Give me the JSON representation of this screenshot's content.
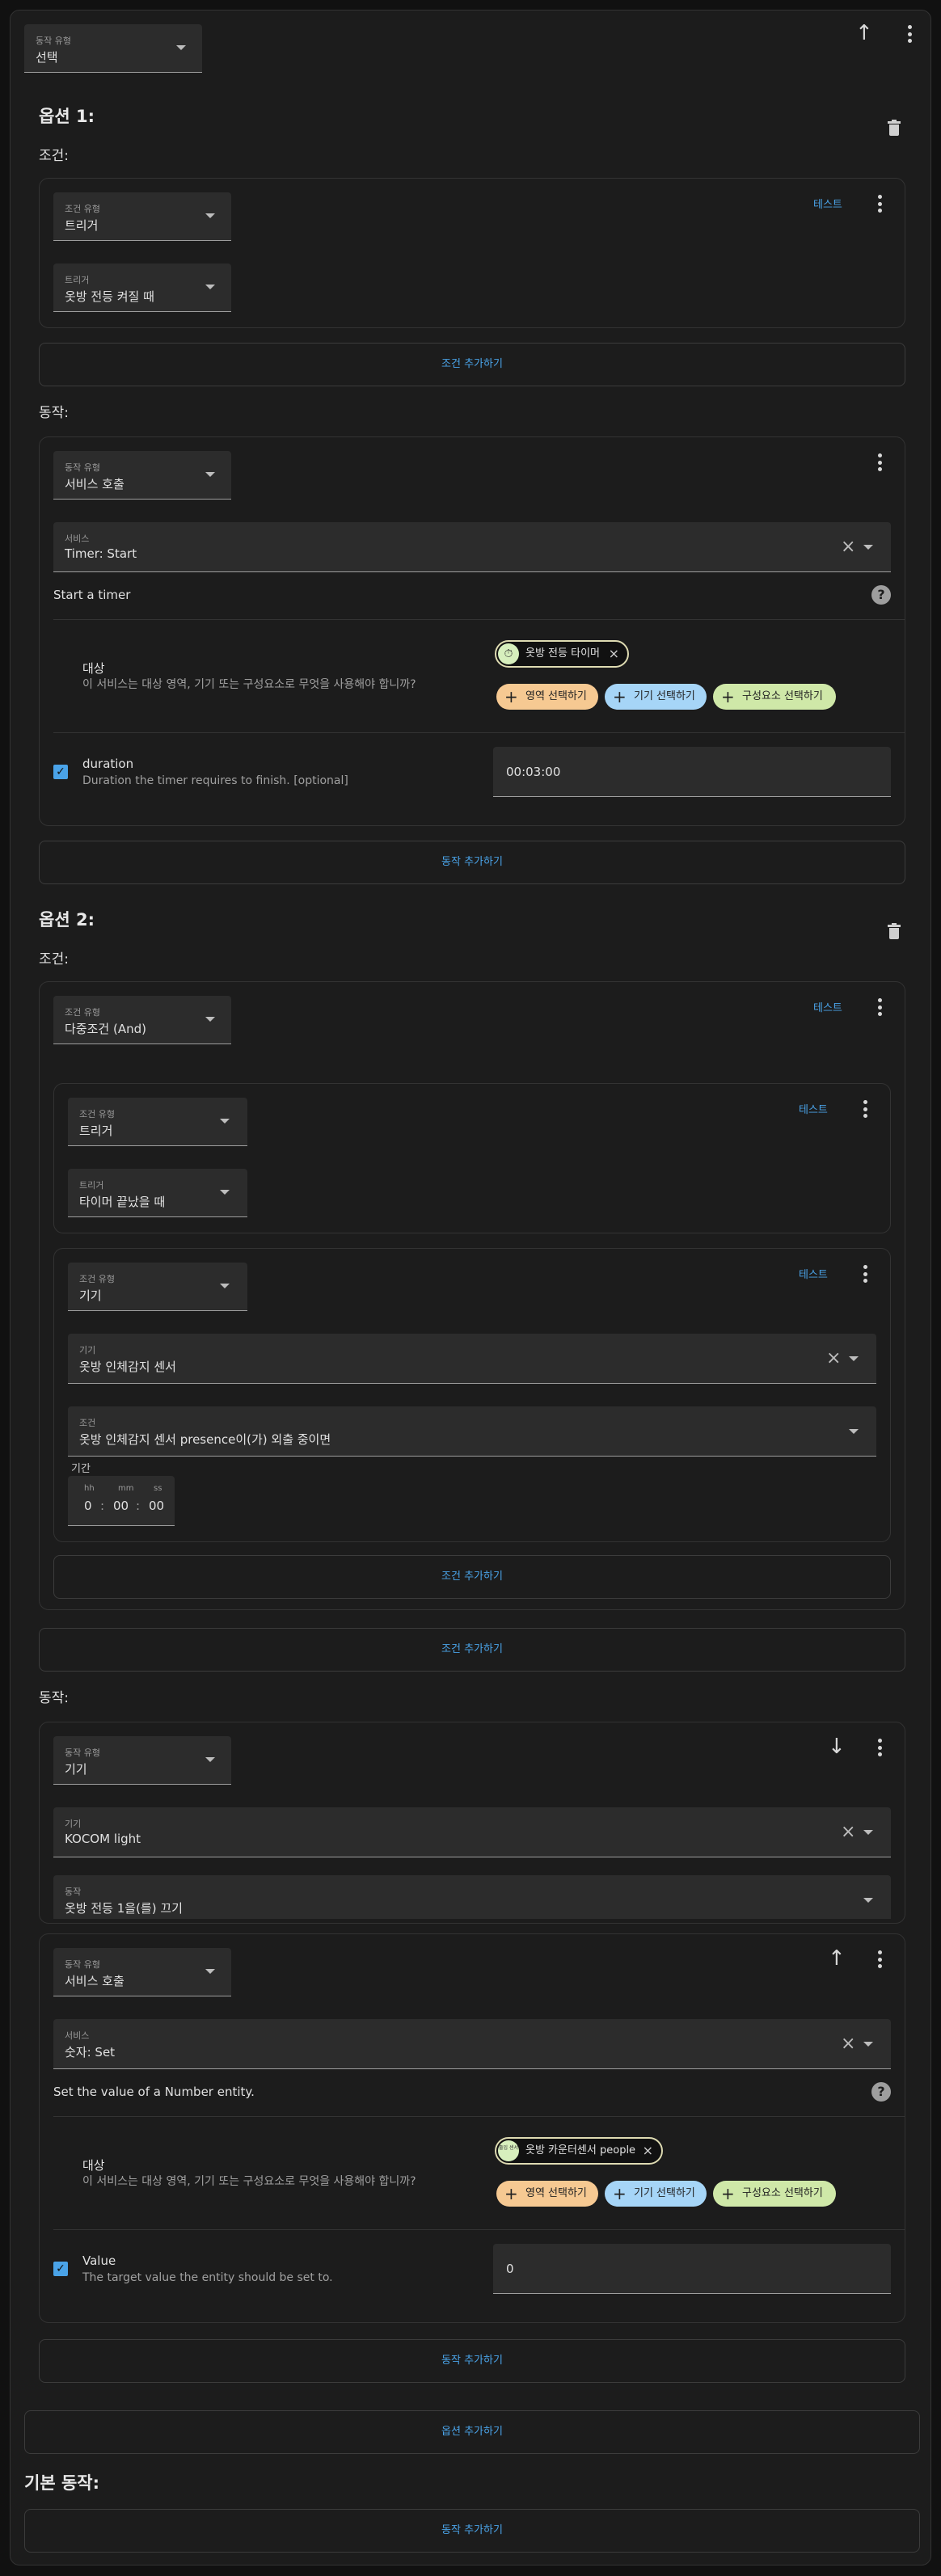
{
  "top": {
    "action_type_label": "동작 유형",
    "action_type_value": "선택"
  },
  "option1": {
    "title": "옵션 1:",
    "conditions_label": "조건:",
    "condition": {
      "type_label": "조건 유형",
      "type_value": "트리거",
      "trigger_label": "트리거",
      "trigger_value": "옷방 전등 켜질 때",
      "test_label": "테스트"
    },
    "add_condition_label": "조건 추가하기",
    "actions_label": "동작:",
    "action": {
      "type_label": "동작 유형",
      "type_value": "서비스 호출",
      "service_label": "서비스",
      "service_value": "Timer: Start",
      "description": "Start a timer",
      "target_label": "대상",
      "target_desc": "이 서비스는 대상 영역, 기기 또는 구성요소로 무엇을 사용해야 합니까?",
      "target_chip": "옷방 전등 타이머",
      "area_chip": "영역 선택하기",
      "device_chip": "기기 선택하기",
      "entity_chip": "구성요소 선택하기",
      "param_name": "duration",
      "param_desc": "Duration the timer requires to finish. [optional]",
      "param_value": "00:03:00"
    },
    "add_action_label": "동작 추가하기"
  },
  "option2": {
    "title": "옵션 2:",
    "conditions_label": "조건:",
    "condition": {
      "type_label": "조건 유형",
      "type_value": "다중조건 (And)",
      "test_label": "테스트",
      "sub1": {
        "type_label": "조건 유형",
        "type_value": "트리거",
        "trigger_label": "트리거",
        "trigger_value": "타이머 끝났을 때",
        "test_label": "테스트"
      },
      "sub2": {
        "type_label": "조건 유형",
        "type_value": "기기",
        "test_label": "테스트",
        "device_label": "기기",
        "device_value": "옷방 인체감지 센서",
        "cond_label": "조건",
        "cond_value": "옷방 인체감지 센서 presence이(가) 외출 중이면",
        "period_label": "기간",
        "hh_label": "hh",
        "mm_label": "mm",
        "ss_label": "ss",
        "hh_value": "0",
        "mm_value": "00",
        "ss_value": "00"
      },
      "inner_add_condition_label": "조건 추가하기"
    },
    "add_condition_label": "조건 추가하기",
    "actions_label": "동작:",
    "action1": {
      "type_label": "동작 유형",
      "type_value": "기기",
      "device_label": "기기",
      "device_value": "KOCOM light",
      "action_label": "동작",
      "action_value": "옷방 전등 1을(를) 끄기"
    },
    "action2": {
      "type_label": "동작 유형",
      "type_value": "서비스 호출",
      "service_label": "서비스",
      "service_value": "숫자: Set",
      "description": "Set the value of a Number entity.",
      "target_label": "대상",
      "target_desc": "이 서비스는 대상 영역, 기기 또는 구성요소로 무엇을 사용해야 합니까?",
      "target_chip": "옷방 카운터센서 people",
      "target_chip_icon": "출입 센서",
      "area_chip": "영역 선택하기",
      "device_chip": "기기 선택하기",
      "entity_chip": "구성요소 선택하기",
      "param_name": "Value",
      "param_desc": "The target value the entity should be set to.",
      "param_value": "0"
    },
    "add_action_label": "동작 추가하기"
  },
  "add_option_label": "옵션 추가하기",
  "default_actions_title": "기본 동작:",
  "default_add_action_label": "동작 추가하기",
  "accent_color": "#4aa3e8",
  "icons": [
    "arrow-up-icon",
    "arrow-down-icon",
    "more-vert-icon",
    "delete-icon",
    "close-icon",
    "chevron-down-icon",
    "help-icon",
    "timer-icon",
    "plus-icon",
    "checkbox-icon"
  ]
}
